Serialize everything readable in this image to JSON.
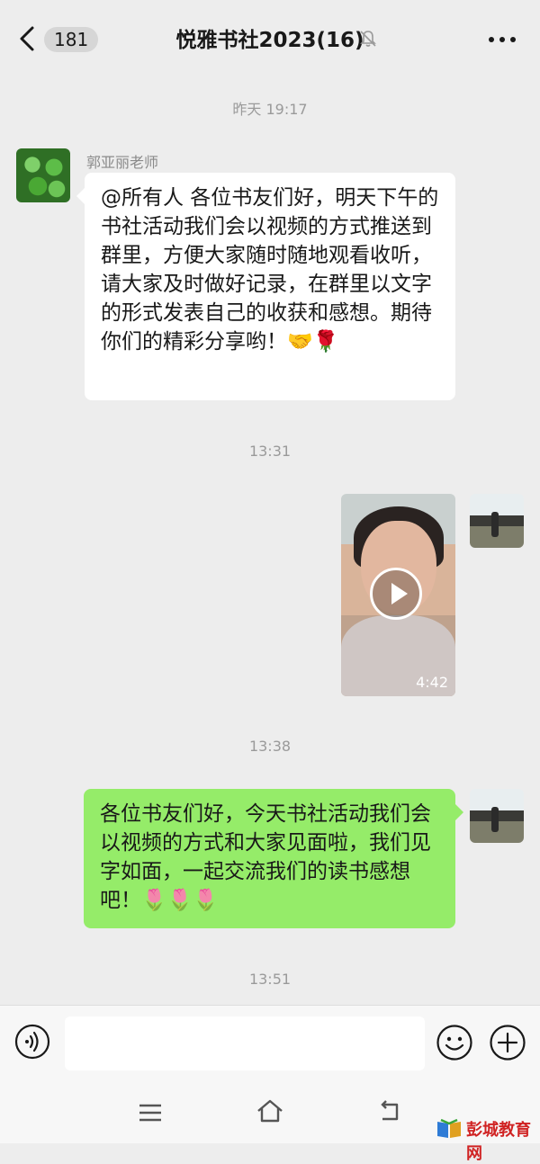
{
  "header": {
    "back_count": "181",
    "title": "悦雅书社2023(16)"
  },
  "messages": {
    "ts1": "昨天 19:17",
    "msg1": {
      "sender": "郭亚丽老师",
      "text": "@所有人 各位书友们好，明天下午的书社活动我们会以视频的方式推送到群里，方便大家随时随地观看收听，请大家及时做好记录，在群里以文字的形式发表自己的收获和感想。期待你们的精彩分享哟！🤝🌹"
    },
    "ts2": "13:31",
    "video": {
      "duration": "4:42"
    },
    "ts3": "13:38",
    "msg2": {
      "text": "各位书友们好，今天书社活动我们会以视频的方式和大家见面啦，我们见字如面，一起交流我们的读书感想吧！🌷🌷🌷"
    },
    "ts4": "13:51"
  },
  "watermark": {
    "text": "彭城教育网"
  },
  "icons": {
    "back": "chevron-left-icon",
    "mute": "bell-muted-icon",
    "more": "more-dots-icon",
    "voice": "voice-icon",
    "emoji": "emoji-icon",
    "plus": "plus-icon",
    "nav_menu": "menu-icon",
    "nav_home": "home-icon",
    "nav_back": "back-icon"
  },
  "colors": {
    "background": "#ededed",
    "bubble_mine": "#95ec69",
    "bubble_other": "#ffffff",
    "watermark": "#d02323"
  }
}
